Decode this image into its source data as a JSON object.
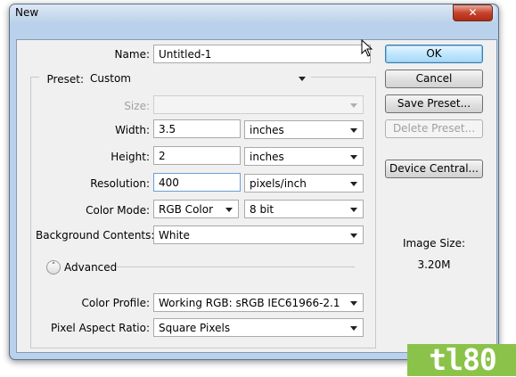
{
  "window": {
    "title": "New",
    "close_glyph": "✕"
  },
  "form": {
    "name": {
      "label": "Name:",
      "value": "Untitled-1"
    },
    "preset": {
      "label": "Preset:",
      "value": "Custom"
    },
    "size": {
      "label": "Size:",
      "value": ""
    },
    "width": {
      "label": "Width:",
      "value": "3.5",
      "unit": "inches"
    },
    "height": {
      "label": "Height:",
      "value": "2",
      "unit": "inches"
    },
    "resolution": {
      "label": "Resolution:",
      "value": "400",
      "unit": "pixels/inch"
    },
    "color_mode": {
      "label": "Color Mode:",
      "value": "RGB Color",
      "depth": "8 bit"
    },
    "background_contents": {
      "label": "Background Contents:",
      "value": "White"
    },
    "advanced": {
      "label": "Advanced",
      "toggle_glyph": "˄"
    },
    "color_profile": {
      "label": "Color Profile:",
      "value": "Working RGB:  sRGB IEC61966-2.1"
    },
    "pixel_aspect_ratio": {
      "label": "Pixel Aspect Ratio:",
      "value": "Square Pixels"
    }
  },
  "buttons": {
    "ok": "OK",
    "cancel": "Cancel",
    "save_preset": "Save Preset...",
    "delete_preset": "Delete Preset...",
    "device_central": "Device Central..."
  },
  "image_size": {
    "label": "Image Size:",
    "value": "3.20M"
  },
  "watermark": {
    "text": "tl80"
  },
  "colors": {
    "accent": "#3c7fb1",
    "title_bar": "#b9d1ea",
    "watermark": "#8bc34a"
  }
}
